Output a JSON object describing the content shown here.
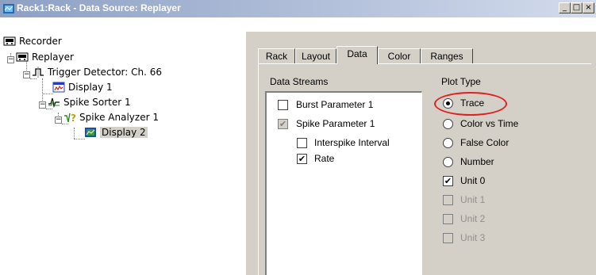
{
  "window": {
    "title": "Rack1:Rack - Data Source: Replayer",
    "buttons": {
      "minimize": "_",
      "maximize": "□",
      "close": "×"
    }
  },
  "tree": {
    "items": [
      {
        "label": "Recorder",
        "icon": "recorder-icon"
      },
      {
        "label": "Replayer",
        "icon": "replayer-icon"
      },
      {
        "label": "Trigger Detector: Ch. 66",
        "icon": "trigger-detector-icon"
      },
      {
        "label": "Display 1",
        "icon": "display-icon"
      },
      {
        "label": "Spike Sorter 1",
        "icon": "spike-sorter-icon"
      },
      {
        "label": "Spike Analyzer 1",
        "icon": "spike-analyzer-icon"
      },
      {
        "label": "Display 2",
        "icon": "display-chart-icon"
      }
    ]
  },
  "tabs": [
    "Rack",
    "Layout",
    "Data",
    "Color",
    "Ranges"
  ],
  "active_tab": "Data",
  "data_streams": {
    "heading": "Data Streams",
    "items": [
      {
        "label": "Burst Parameter 1",
        "checked": false
      },
      {
        "label": "Spike Parameter 1",
        "checked": true,
        "disabled": true
      },
      {
        "label": "Interspike Interval",
        "checked": false
      },
      {
        "label": "Rate",
        "checked": true
      }
    ]
  },
  "plot_type": {
    "heading": "Plot Type",
    "options": [
      "Trace",
      "Color vs Time",
      "False Color",
      "Number"
    ],
    "selected": "Trace",
    "units": [
      {
        "label": "Unit 0",
        "checked": true,
        "disabled": false
      },
      {
        "label": "Unit 1",
        "checked": false,
        "disabled": true
      },
      {
        "label": "Unit 2",
        "checked": false,
        "disabled": true
      },
      {
        "label": "Unit 3",
        "checked": false,
        "disabled": true
      }
    ]
  },
  "colors": {
    "highlight_ellipse": "#e02020",
    "titlebar": "#8da0c4"
  }
}
